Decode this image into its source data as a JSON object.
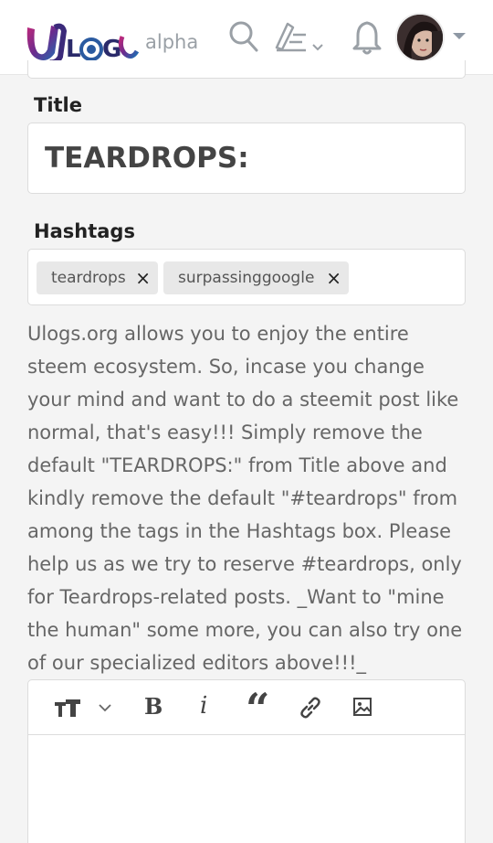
{
  "header": {
    "logo_text": "ULOGS",
    "badge": "alpha",
    "icons": [
      "search-icon",
      "pen-list-icon",
      "chevron-down-icon",
      "bell-icon",
      "avatar",
      "caret-down-icon"
    ]
  },
  "form": {
    "title_label": "Title",
    "title_value": "TEARDROPS:",
    "hashtags_label": "Hashtags",
    "tags": [
      {
        "label": "teardrops",
        "remove": "×"
      },
      {
        "label": "surpassinggoogle",
        "remove": "×"
      }
    ],
    "notice": "Ulogs.org allows you to enjoy the entire steem ecosystem. So, incase you change your mind and want to do a steemit post like normal, that's easy!!! Simply remove the default \"TEARDROPS:\" from Title above and kindly remove the default \"#teardrops\" from among the tags in the Hashtags box. Please help us as we try to reserve #teardrops, only for Teardrops-related posts. _Want to \"mine the human\" some more, you can also try one of our specialized editors above!!!_"
  },
  "editor": {
    "toolbar": {
      "bold": "B",
      "italic": "i",
      "quote": "“",
      "icons": [
        "heading-icon",
        "chevron-down-icon",
        "bold-icon",
        "italic-icon",
        "quote-icon",
        "link-icon",
        "image-icon"
      ]
    },
    "body": ""
  },
  "colors": {
    "logo_purple": "#5a2a7a",
    "logo_blue": "#1d6fb3",
    "logo_magenta": "#c0287a",
    "text_muted": "#666666",
    "chip_bg": "#e8e8e8"
  }
}
